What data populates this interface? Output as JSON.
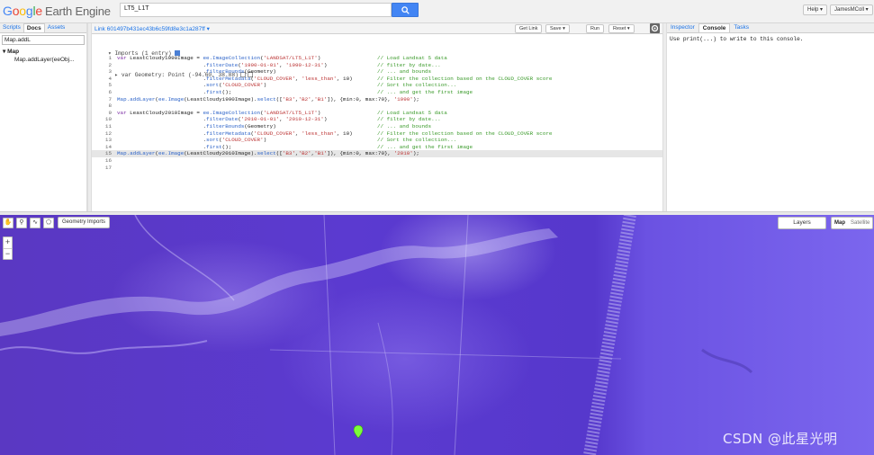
{
  "header": {
    "logo_google": [
      "G",
      "o",
      "o",
      "g",
      "l",
      "e"
    ],
    "logo_product": "Earth Engine",
    "search_value": "LT5_L1T",
    "help_label": "Help ▾",
    "user_label": "JamesMColl ▾"
  },
  "left_panel": {
    "tabs": [
      "Scripts",
      "Docs",
      "Assets"
    ],
    "active_tab": "Docs",
    "filter_value": "Map.addL",
    "tree_root": "▾ Map",
    "tree_child": "Map.addLayer(eeObj..."
  },
  "editor": {
    "link_label": "Link 601497b431ec43b6c59fd8e3c1a287ff ▾",
    "buttons": {
      "get_link": "Get Link",
      "save": "Save ▾",
      "run": "Run",
      "reset": "Reset ▾"
    },
    "imports_header": "▾ Imports (1 entry)",
    "imports_entry": "  ▸ var Geometry: Point (-94.60, 38.88)",
    "lines": [
      {
        "n": "1",
        "code": "var LeastCloudy1990Image = ee.ImageCollection('LANDSAT/LT5_L1T')",
        "comment": "// Load Landsat 5 data"
      },
      {
        "n": "2",
        "code": "                           .filterDate('1990-01-01', '1990-12-31')",
        "comment": "// filter by date..."
      },
      {
        "n": "3",
        "code": "                           .filterBounds(Geometry)",
        "comment": "// ... and bounds"
      },
      {
        "n": "4",
        "code": "                           .filterMetadata('CLOUD_COVER', 'less_than', 10)",
        "comment": "// Filter the collection based on the CLOUD_COVER score"
      },
      {
        "n": "5",
        "code": "                           .sort('CLOUD_COVER')",
        "comment": "// Sort the collection..."
      },
      {
        "n": "6",
        "code": "                           .first();",
        "comment": "// ... and get the first image"
      },
      {
        "n": "7",
        "code": "Map.addLayer(ee.Image(LeastCloudy1990Image).select(['B3','B2','B1']), {min:0, max:70}, '1990');",
        "comment": ""
      },
      {
        "n": "8",
        "code": "",
        "comment": ""
      },
      {
        "n": "9",
        "code": "var LeastCloudy2010Image = ee.ImageCollection('LANDSAT/LT5_L1T')",
        "comment": "// Load Landsat 5 data"
      },
      {
        "n": "10",
        "code": "                           .filterDate('2010-01-01', '2010-12-31')",
        "comment": "// filter by date..."
      },
      {
        "n": "11",
        "code": "                           .filterBounds(Geometry)",
        "comment": "// ... and bounds"
      },
      {
        "n": "12",
        "code": "                           .filterMetadata('CLOUD_COVER', 'less_than', 10)",
        "comment": "// Filter the collection based on the CLOUD_COVER score"
      },
      {
        "n": "13",
        "code": "                           .sort('CLOUD_COVER')",
        "comment": "// Sort the collection..."
      },
      {
        "n": "14",
        "code": "                           .first();",
        "comment": "// ... and get the first image"
      },
      {
        "n": "15",
        "code": "Map.addLayer(ee.Image(LeastCloudy2010Image).select(['B3','B2','B1']), {min:0, max:70}, '2010');",
        "comment": "",
        "highlight": true
      },
      {
        "n": "16",
        "code": "",
        "comment": ""
      },
      {
        "n": "17",
        "code": "",
        "comment": ""
      }
    ]
  },
  "right_panel": {
    "tabs": [
      "Inspector",
      "Console",
      "Tasks"
    ],
    "active_tab": "Console",
    "console_message": "Use print(...) to write to this console."
  },
  "map": {
    "geometry_imports_label": "Geometry Imports",
    "zoom_in": "+",
    "zoom_out": "−",
    "layers_label": "Layers",
    "map_type_map": "Map",
    "map_type_satellite": "Satellite",
    "watermark": "CSDN @此星光明"
  },
  "colors": {
    "accent": "#4285f4",
    "map_base": "#5a38c2",
    "pin": "#7cfc3a"
  }
}
